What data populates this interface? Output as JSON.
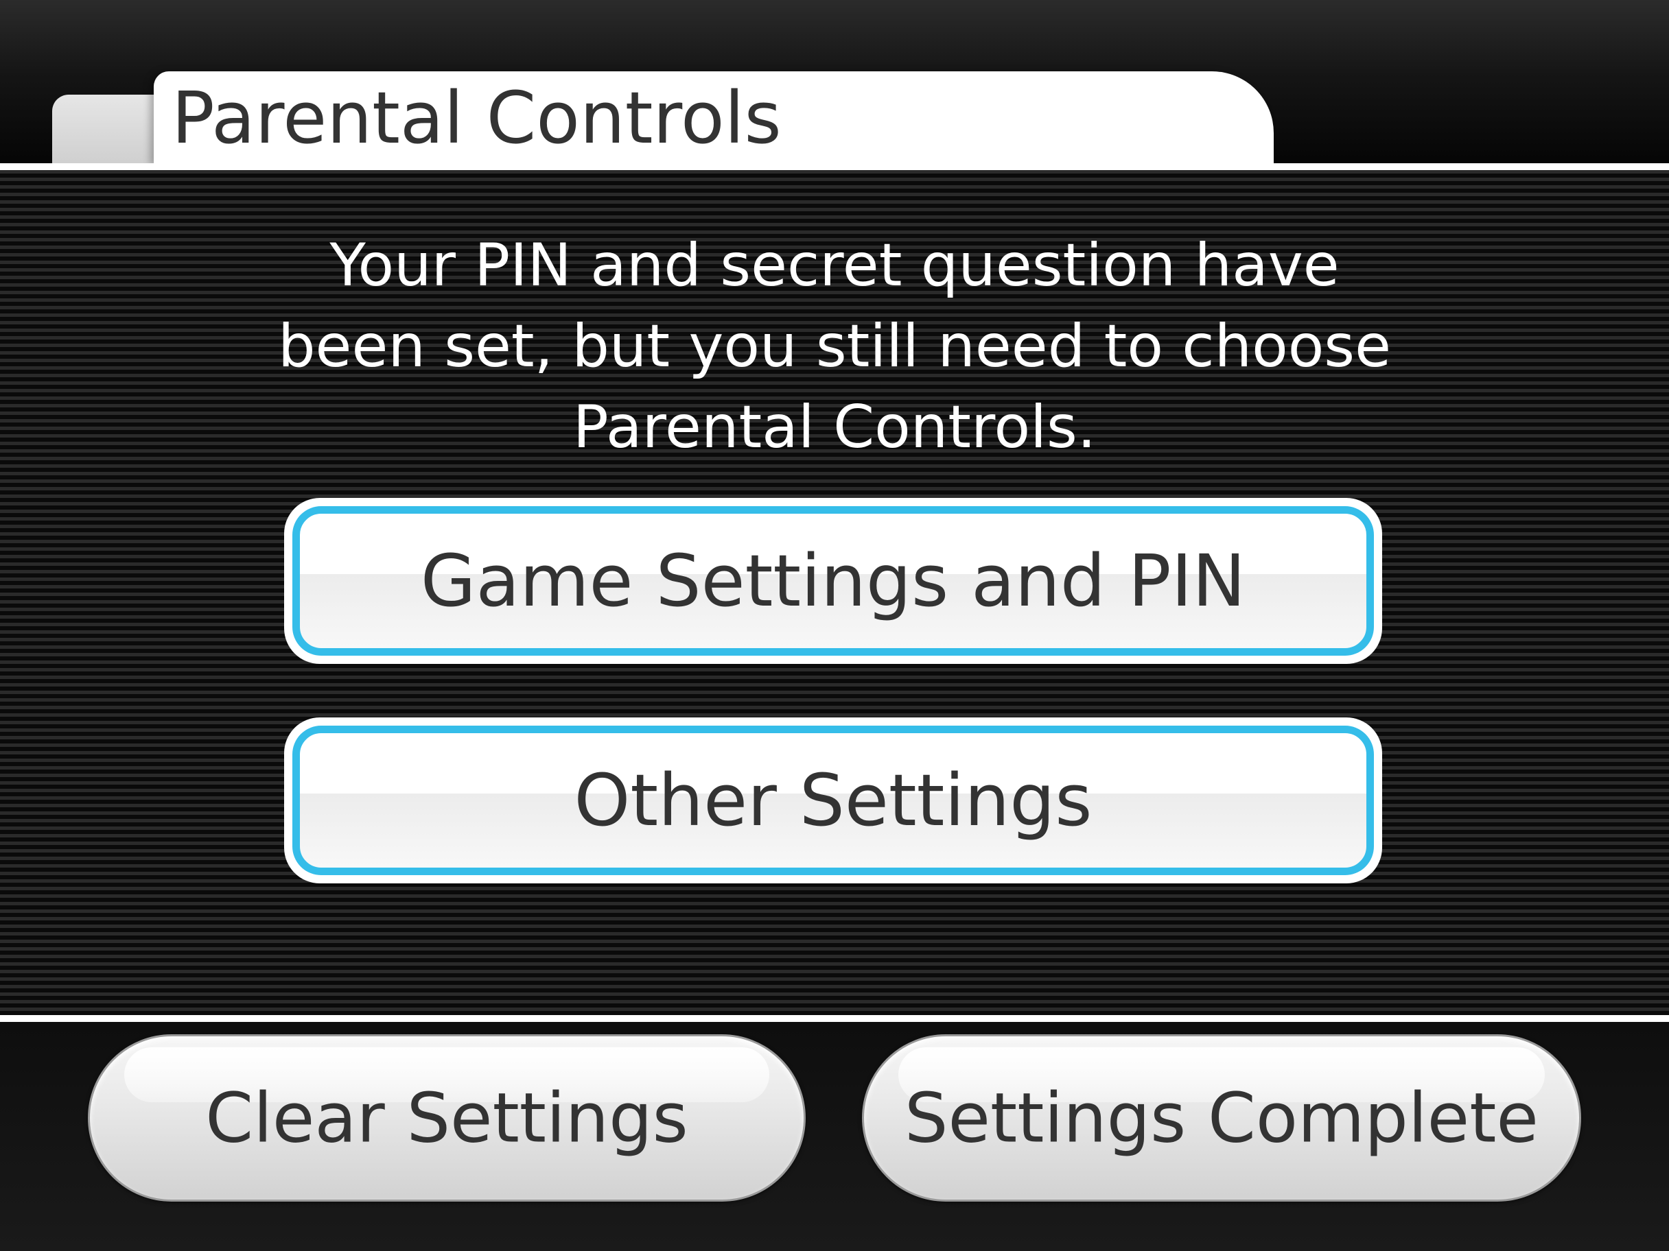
{
  "header": {
    "title": "Parental Controls"
  },
  "main": {
    "message": "Your PIN and secret question have\nbeen set, but you still need to choose\nParental Controls.",
    "options": [
      {
        "label": "Game Settings and PIN"
      },
      {
        "label": "Other Settings"
      }
    ]
  },
  "footer": {
    "clear_label": "Clear Settings",
    "complete_label": "Settings Complete"
  },
  "colors": {
    "accent_outline": "#35bde9",
    "text_dark": "#333333",
    "text_light": "#ffffff",
    "background": "#000000"
  }
}
